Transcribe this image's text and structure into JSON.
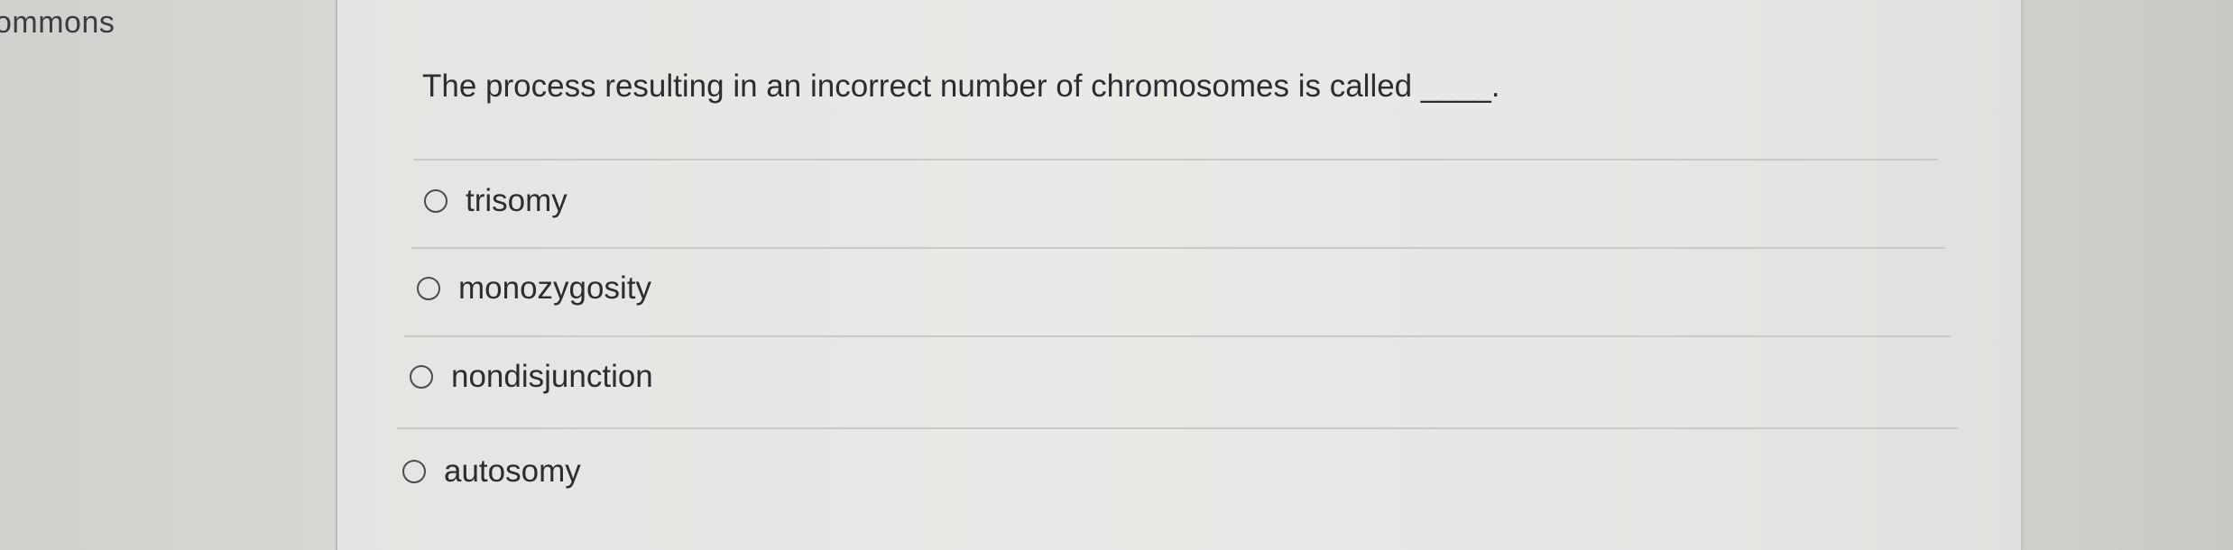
{
  "sidebar": {
    "label": "ommons"
  },
  "question": {
    "text": "The process resulting in an incorrect number of chromosomes is called ____."
  },
  "options": [
    {
      "label": "trisomy",
      "selected": false
    },
    {
      "label": "monozygosity",
      "selected": false
    },
    {
      "label": "nondisjunction",
      "selected": false
    },
    {
      "label": "autosomy",
      "selected": false
    }
  ]
}
